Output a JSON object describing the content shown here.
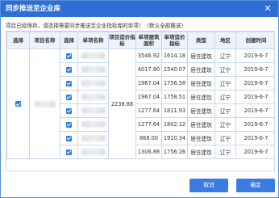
{
  "dialog": {
    "title": "同步推送至企业库",
    "close_glyph": "✕",
    "notice": "项目已经保存，请选择需要同步推送至企业指标库的单项！（默认全部推送）"
  },
  "table": {
    "headers": [
      "选择",
      "项目名称",
      "选择",
      "单项名称",
      "项目造价指标",
      "单项建筑面积",
      "单项造价指标",
      "类型",
      "地区",
      "创建时间"
    ],
    "project_price": "2238.88",
    "rows": [
      {
        "area": "3546.92",
        "price": "1614.18",
        "type": "居住建筑",
        "region": "辽宁",
        "date": "2019-6-7"
      },
      {
        "area": "4017.80",
        "price": "1540.07",
        "type": "居住建筑",
        "region": "辽宁",
        "date": "2019-6-7"
      },
      {
        "area": "1967.04",
        "price": "1756.58",
        "type": "居住建筑",
        "region": "辽宁",
        "date": "2019-6-7"
      },
      {
        "area": "1967.04",
        "price": "1758.51",
        "type": "居住建筑",
        "region": "辽宁",
        "date": "2019-6-7"
      },
      {
        "area": "1277.64",
        "price": "1811.93",
        "type": "居住建筑",
        "region": "辽宁",
        "date": "2019-6-7"
      },
      {
        "area": "1277.64",
        "price": "1802.12",
        "type": "居住建筑",
        "region": "辽宁",
        "date": "2019-6-7"
      },
      {
        "area": "868.00",
        "price": "1910.34",
        "type": "居住建筑",
        "region": "辽宁",
        "date": "2019-6-7"
      },
      {
        "area": "1306.88",
        "price": "1756.26",
        "type": "居住建筑",
        "region": "辽宁",
        "date": "2019-6-7"
      }
    ]
  },
  "footer": {
    "cancel_label": "取消",
    "ok_label": "确定"
  },
  "colors": {
    "title_bar": "#2f6fd4",
    "checkbox": "#2f7fe0",
    "button": "#3a7be0"
  }
}
